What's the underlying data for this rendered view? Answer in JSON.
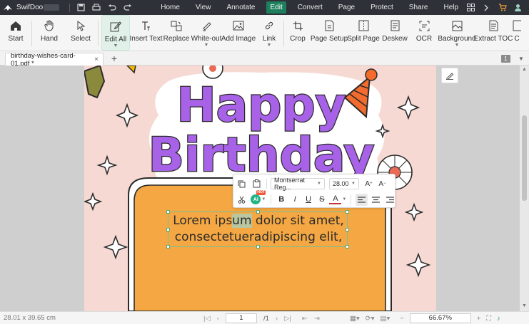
{
  "app": {
    "name": "SwifDoo"
  },
  "menu": [
    "Home",
    "View",
    "Annotate",
    "Edit",
    "Convert",
    "Page",
    "Protect",
    "Share",
    "Help"
  ],
  "menu_active": "Edit",
  "ribbon": {
    "tools": [
      {
        "label": "Start",
        "icon": "start-icon"
      },
      {
        "label": "Hand",
        "icon": "hand-icon"
      },
      {
        "label": "Select",
        "icon": "select-icon"
      },
      {
        "label": "Edit All",
        "icon": "edit-all-icon"
      },
      {
        "label": "Insert Text",
        "icon": "insert-text-icon"
      },
      {
        "label": "Replace",
        "icon": "replace-icon"
      },
      {
        "label": "White-out",
        "icon": "white-out-icon"
      },
      {
        "label": "Add Image",
        "icon": "add-image-icon"
      },
      {
        "label": "Link",
        "icon": "link-icon"
      },
      {
        "label": "Crop",
        "icon": "crop-icon"
      },
      {
        "label": "Page Setup",
        "icon": "page-setup-icon"
      },
      {
        "label": "Split Page",
        "icon": "split-page-icon"
      },
      {
        "label": "Deskew",
        "icon": "deskew-icon"
      },
      {
        "label": "OCR",
        "icon": "ocr-icon"
      },
      {
        "label": "Background",
        "icon": "background-icon"
      },
      {
        "label": "Extract TOC",
        "icon": "extract-toc-icon"
      },
      {
        "label": "C",
        "icon": "more-icon"
      }
    ]
  },
  "tab": {
    "filename": "birthday-wishes-card-01.pdf *",
    "close": "×",
    "add": "+"
  },
  "page_count_badge": "1",
  "card": {
    "title_line1": "Happy",
    "title_line2": "Birthday"
  },
  "textbox": {
    "line1_a": "Lorem ips",
    "line1_hl": "um",
    "line1_b": " dolor sit amet,",
    "line2": "consectetueradipiscing elit,"
  },
  "format_toolbar": {
    "font": "Montserrat Reg...",
    "size": "28.00",
    "ai_label": "AI",
    "hot_label": "HOT",
    "bold": "B",
    "italic": "I",
    "underline": "U",
    "strike": "S",
    "color": "A",
    "colors": {
      "text_underline": "#c0392b"
    }
  },
  "status": {
    "dimensions": "28.01 x 39.65 cm",
    "page_current": "1",
    "page_total": "/1",
    "zoom": "66.67%"
  },
  "colors": {
    "titlebar": "#2e3138",
    "accent": "#1e7f5d",
    "card_bg": "#f7d9d3",
    "title_fill": "#a862e8",
    "orange_panel": "#f4a742",
    "hat": "#f36b2d"
  }
}
